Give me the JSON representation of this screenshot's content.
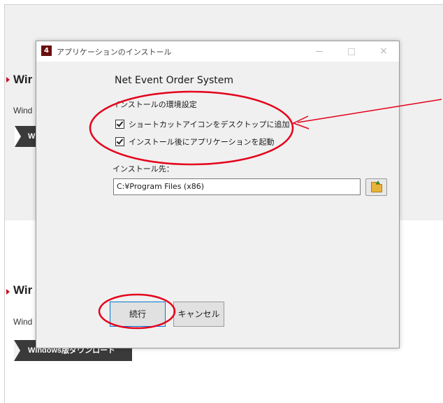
{
  "background_page": {
    "section_top": {
      "title": "Wir",
      "description": "Wind",
      "download_label": "W"
    },
    "section_bottom": {
      "title": "Wir",
      "description": "Wind",
      "download_label": "Windows版ダウンロード"
    }
  },
  "dialog": {
    "title": "アプリケーションのインストール",
    "app_icon_glyph": "4",
    "product_name": "Net Event Order System",
    "install_settings_label": "インストールの環境設定",
    "options": [
      {
        "label": "ショートカットアイコンをデスクトップに追加",
        "checked": true
      },
      {
        "label": "インストール後にアプリケーションを起動",
        "checked": true
      }
    ],
    "destination_label": "インストール先：",
    "destination_value": "C:¥Program Files (x86)",
    "browse_icon": "folder-icon",
    "continue_label": "続行",
    "cancel_label": "キャンセル",
    "window_controls": {
      "minimize": "minimize-icon",
      "maximize": "maximize-icon",
      "close": "×"
    }
  },
  "colors": {
    "annotation": "#e4001b",
    "accent_red": "#c8102e",
    "button_dark": "#3a3a3a",
    "dialog_bg": "#f0f0f0"
  }
}
